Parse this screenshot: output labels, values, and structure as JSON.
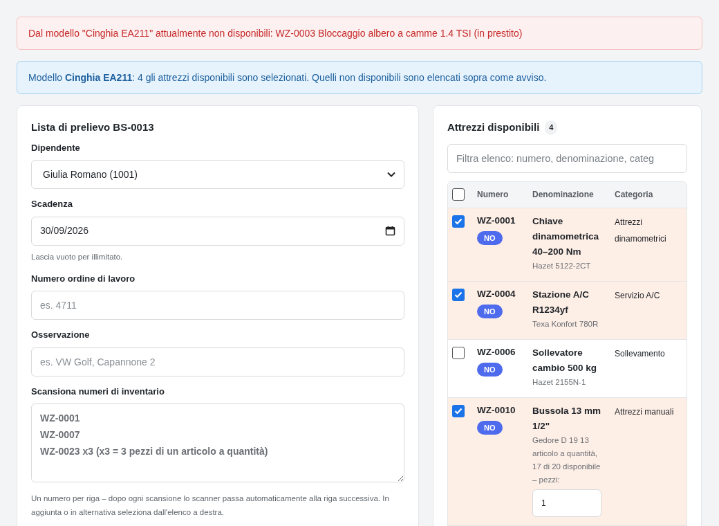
{
  "alerts": [
    {
      "kind": "error",
      "text": "Dal modello \"Cinghia EA211\" attualmente non disponibili: WZ-0003 Bloccaggio albero a camme 1.4 TSI (in prestito)"
    },
    {
      "kind": "info",
      "text": "Modello **Cinghia EA211**: 4 gli attrezzi disponibili sono selezionati. Quelli non disponibili sono elencati sopra come avviso."
    }
  ],
  "form": {
    "title": "Lista di prelievo BS-0013",
    "fields": [
      {
        "kind": "select",
        "label": "Dipendente",
        "value": "Giulia Romano (1001)"
      },
      {
        "kind": "date",
        "label": "Scadenza",
        "value": "30/09/2026",
        "hint": "Lascia vuoto per illimitato."
      },
      {
        "kind": "text",
        "label": "Numero ordine di lavoro",
        "placeholder": "es. 4711"
      },
      {
        "kind": "text",
        "label": "Osservazione",
        "placeholder": "es. VW Golf, Capannone 2"
      },
      {
        "kind": "textarea",
        "label": "Scansiona numeri di inventario",
        "lines": [
          "WZ-0001",
          "WZ-0007",
          "WZ-0023 x3 (x3 = 3 pezzi di un articolo a quantità)"
        ],
        "hint": "Un numero per riga – dopo ogni scansione lo scanner passa automaticamente alla riga successiva. In aggiunta o in alternativa seleziona dall'elenco a destra."
      }
    ]
  },
  "tools": {
    "title": "Attrezzi disponibili",
    "count": "4",
    "filter_placeholder": "Filtra elenco: numero, denominazione, categ",
    "select_all": {
      "checked": false
    },
    "columns": [
      "Numero",
      "Denominazione",
      "Categoria"
    ],
    "rows": [
      {
        "selected": true,
        "number": "WZ-0001",
        "badge": "NO",
        "name": "Chiave dinamometrica 40–200 Nm",
        "detail": "Hazet 5122-2CT",
        "category": "Attrezzi dinamometrici"
      },
      {
        "selected": true,
        "number": "WZ-0004",
        "badge": "NO",
        "name": "Stazione A/C R1234yf",
        "detail": "Texa Konfort 780R",
        "category": "Servizio A/C"
      },
      {
        "selected": false,
        "number": "WZ-0006",
        "badge": "NO",
        "name": "Sollevatore cambio 500 kg",
        "detail": "Hazet 2155N-1",
        "category": "Sollevamento"
      },
      {
        "selected": true,
        "number": "WZ-0010",
        "badge": "NO",
        "name": "Bussola 13 mm 1/2\"",
        "detail": "Gedore D 19 13",
        "quantity_note": "articolo a quantità, 17 di 20 disponibile – pezzi:",
        "quantity": "1",
        "category": "Attrezzi manuali"
      }
    ]
  }
}
